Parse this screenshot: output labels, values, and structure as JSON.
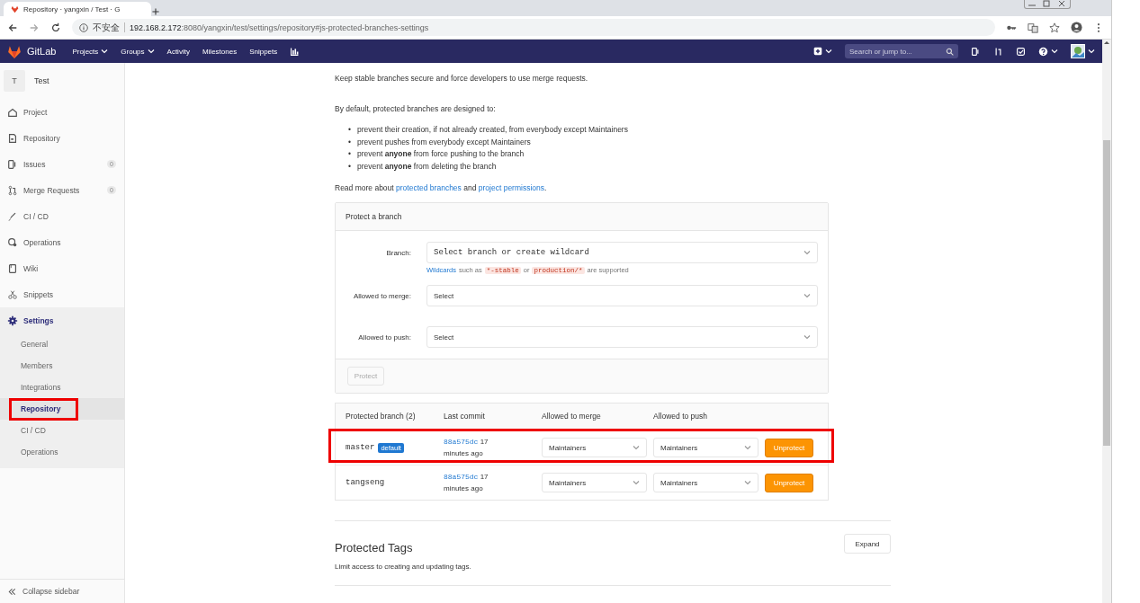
{
  "browser": {
    "tab_title": "Repository · yangxin / Test · G",
    "security_label": "不安全",
    "url_host": "192.168.2.172",
    "url_rest": ":8080/yangxin/test/settings/repository#js-protected-branches-settings"
  },
  "navbar": {
    "brand": "GitLab",
    "items": [
      {
        "label": "Projects",
        "dropdown": true
      },
      {
        "label": "Groups",
        "dropdown": true
      },
      {
        "label": "Activity",
        "dropdown": false
      },
      {
        "label": "Milestones",
        "dropdown": false
      },
      {
        "label": "Snippets",
        "dropdown": false
      }
    ],
    "search": {
      "placeholder": "Search or jump to..."
    }
  },
  "sidebar": {
    "project": {
      "initial": "T",
      "name": "Test"
    },
    "items": [
      {
        "label": "Project",
        "selected": false
      },
      {
        "label": "Repository",
        "selected": false
      },
      {
        "label": "Issues",
        "count": "0",
        "selected": false
      },
      {
        "label": "Merge Requests",
        "count": "0",
        "selected": false
      },
      {
        "label": "CI / CD",
        "selected": false
      },
      {
        "label": "Operations",
        "selected": false
      },
      {
        "label": "Wiki",
        "selected": false
      },
      {
        "label": "Snippets",
        "selected": false
      },
      {
        "label": "Settings",
        "selected": true,
        "children": [
          {
            "label": "General",
            "selected": false,
            "highlighted": false
          },
          {
            "label": "Members",
            "selected": false,
            "highlighted": false
          },
          {
            "label": "Integrations",
            "selected": false,
            "highlighted": false
          },
          {
            "label": "Repository",
            "selected": true,
            "highlighted": true
          },
          {
            "label": "CI / CD",
            "selected": false,
            "highlighted": false
          },
          {
            "label": "Operations",
            "selected": false,
            "highlighted": false
          }
        ]
      }
    ],
    "collapse": "Collapse sidebar"
  },
  "branches": {
    "intro": "Keep stable branches secure and force developers to use merge requests.",
    "defaults_heading": "By default, protected branches are designed to:",
    "bullets": [
      {
        "marker": "•",
        "text": "prevent their creation, if not already created, from everybody except Maintainers"
      },
      {
        "marker": "•",
        "text": "prevent pushes from everybody except Maintainers"
      },
      {
        "marker": "•",
        "text": "prevent **anyone** from force pushing to the branch"
      },
      {
        "marker": "•",
        "text": "prevent **anyone** from deleting the branch"
      }
    ],
    "read_more": {
      "prefix": "Read more about",
      "link_1": "protected branches",
      "middle": "and",
      "link_2": "project permissions",
      "suffix": "."
    },
    "form": {
      "title": "Protect a branch",
      "branch": {
        "label": "Branch:",
        "placeholder": "Select branch or create wildcard"
      },
      "hint": {
        "link": "Wildcards",
        "text_1": "such as",
        "code_1": "*-stable",
        "text_2": "or",
        "code_2": "production/*",
        "text_3": "are supported"
      },
      "merge": {
        "label": "Allowed to merge:",
        "value": "Select"
      },
      "push": {
        "label": "Allowed to push:",
        "value": "Select"
      },
      "button": {
        "label": "Protect",
        "disabled": true
      }
    },
    "table": {
      "columns": [
        "Protected branch (2)",
        "Last commit",
        "Allowed to merge",
        "Allowed to push"
      ],
      "rows": [
        {
          "branch": "master",
          "badge": "default",
          "commit": "88a575dc",
          "time": "17 minutes ago",
          "merge": "Maintainers",
          "push": "Maintainers",
          "action": "Unprotect",
          "highlighted": true
        },
        {
          "branch": "tangseng",
          "commit": "88a575dc",
          "time": "17 minutes ago",
          "merge": "Maintainers",
          "push": "Maintainers",
          "action": "Unprotect",
          "highlighted": false
        }
      ]
    }
  },
  "tags": {
    "title": "Protected Tags",
    "description": "Limit access to creating and updating tags.",
    "button": "Expand"
  }
}
